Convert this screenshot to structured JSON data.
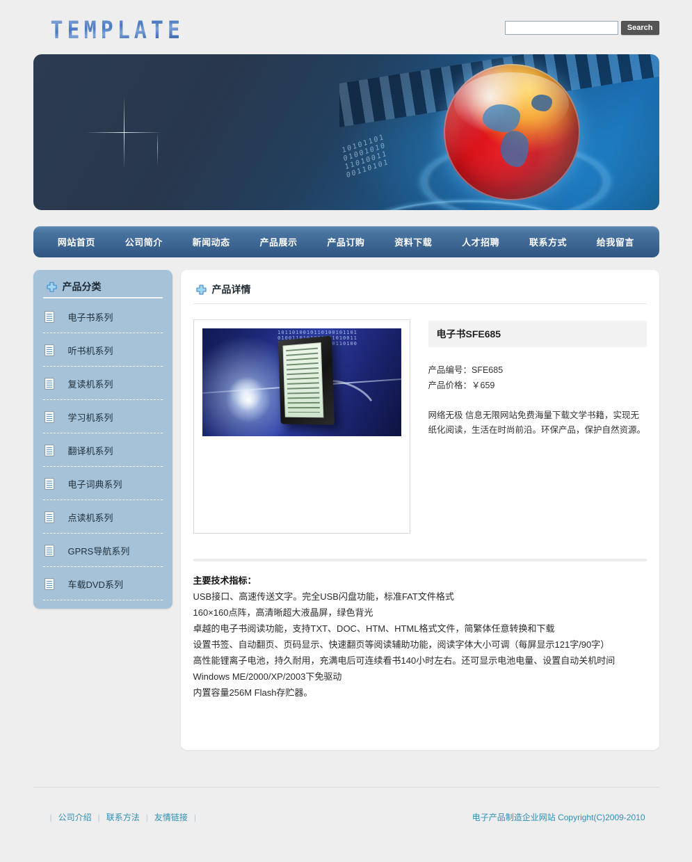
{
  "header": {
    "logo_text": "TEMPLATE",
    "search": {
      "value": "",
      "placeholder": "",
      "button_label": "Search"
    }
  },
  "banner": {
    "binary_text": "10101101\n01001010\n11010011\n00110101",
    "alt": "globe-network-banner"
  },
  "nav": {
    "items": [
      {
        "label": "网站首页"
      },
      {
        "label": "公司简介"
      },
      {
        "label": "新闻动态"
      },
      {
        "label": "产品展示"
      },
      {
        "label": "产品订购"
      },
      {
        "label": "资料下载"
      },
      {
        "label": "人才招聘"
      },
      {
        "label": "联系方式"
      },
      {
        "label": "给我留言"
      }
    ]
  },
  "sidebar": {
    "title": "产品分类",
    "items": [
      {
        "label": "电子书系列"
      },
      {
        "label": "听书机系列"
      },
      {
        "label": "复读机系列"
      },
      {
        "label": "学习机系列"
      },
      {
        "label": "翻译机系列"
      },
      {
        "label": "电子词典系列"
      },
      {
        "label": "点读机系列"
      },
      {
        "label": "GPRS导航系列"
      },
      {
        "label": "车载DVD系列"
      }
    ]
  },
  "main": {
    "title": "产品详情",
    "product": {
      "image_bits": "1011010010110100101101\n0100110101001101010011\n1101001011010010110100",
      "name": "电子书SFE685",
      "code_line": "产品编号：SFE685",
      "price_line": "产品价格：￥659",
      "description": "网络无极 信息无限网站免费海量下载文学书籍，实现无纸化阅读，生活在时尚前沿。环保产品，保护自然资源。",
      "spec_title": "主要技术指标：",
      "spec_lines": [
        "USB接口、高速传送文字。完全USB闪盘功能，标准FAT文件格式",
        "160×160点阵，高清晰超大液晶屏，绿色背光",
        "卓越的电子书阅读功能，支持TXT、DOC、HTM、HTML格式文件，简繁体任意转换和下载",
        "设置书签、自动翻页、页码显示、快速翻页等阅读辅助功能，阅读字体大小可调（每屏显示121字/90字）",
        "高性能锂离子电池，持久耐用，充满电后可连续看书140小时左右。还可显示电池电量、设置自动关机时间",
        "Windows ME/2000/XP/2003下免驱动",
        "内置容量256M Flash存贮器。"
      ]
    }
  },
  "footer": {
    "links": [
      {
        "label": "公司介绍"
      },
      {
        "label": "联系方法"
      },
      {
        "label": "友情链接"
      }
    ],
    "separator": "|",
    "copyright": "电子产品制造企业网站  Copyright(C)2009-2010"
  },
  "colors": {
    "page_bg": "#eeeeee",
    "nav_blue": "#3d6694",
    "sidebar_blue": "#a5c2d9",
    "accent_link": "#2f8fb5",
    "globe_red": "#e8331f"
  }
}
